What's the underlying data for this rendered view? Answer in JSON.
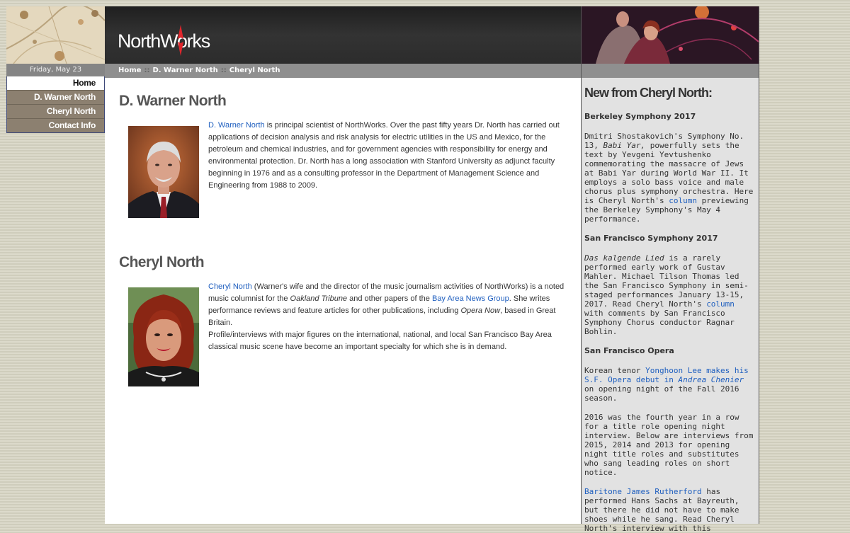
{
  "left": {
    "date": "Friday, May 23",
    "nav": [
      {
        "label": "Home",
        "active": true
      },
      {
        "label": "D. Warner North",
        "active": false
      },
      {
        "label": "Cheryl North",
        "active": false
      },
      {
        "label": "Contact Info",
        "active": false
      }
    ]
  },
  "header": {
    "logo": "NorthWorks",
    "breadcrumbs": [
      "Home",
      "D. Warner North",
      "Cheryl North"
    ],
    "separator": "::"
  },
  "warner": {
    "name": "D. Warner North",
    "bio_link": "D. Warner North",
    "bio_rest": " is principal scientist of NorthWorks. Over the past fifty years Dr. North has carried out applications of decision analysis and risk analysis for electric utilities in the US and Mexico, for the petroleum and chemical industries, and for government agencies with responsibility for energy and environmental protection. Dr. North has a long association with Stanford University as adjunct faculty beginning in 1976 and as a consulting professor in the Department of Management Science and Engineering from 1988 to 2009."
  },
  "cheryl": {
    "name": "Cheryl North",
    "bio_link": "Cheryl North",
    "bio_1": " (Warner's wife and the director of the music journalism activities of NorthWorks) is a noted music columnist for the ",
    "bio_italic_1": "Oakland Tribune",
    "bio_2": " and other papers of the ",
    "bio_link_2": "Bay Area News Group",
    "bio_3": ". She writes performance reviews and feature articles for other publications, including ",
    "bio_italic_2": "Opera Now",
    "bio_4": ", based in Great Britain.",
    "bio_para_2": "Profile/interviews with major figures on the international, national, and local San Francisco Bay Area classical music scene have become an important specialty for which she is in demand."
  },
  "sidebar": {
    "title": "New from Cheryl North:",
    "s1_title": "Berkeley Symphony 2017",
    "s1_a": "Dmitri Shostakovich's Symphony No. 13, ",
    "s1_italic": "Babi Yar,",
    "s1_b": " powerfully sets the text by Yevgeni Yevtushenko commemorating the massacre of Jews at Babi Yar during World War II. It employs a solo bass voice and male chorus plus symphony orchestra. Here is Cheryl North's ",
    "s1_link": "column",
    "s1_c": " previewing the Berkeley Symphony's May 4 performance.",
    "s2_title": "San Francisco Symphony 2017",
    "s2_italic": "Das kalgende Lied",
    "s2_a": " is a rarely performed early work of Gustav Mahler. Michael Tilson Thomas led the San Francisco Symphony in semi-staged performances January 13-15, 2017. Read Cheryl North's ",
    "s2_link": "column",
    "s2_b": " with comments by San Francisco Symphony Chorus conductor Ragnar Bohlin.",
    "s3_title": "San Francisco Opera",
    "s3_a": "Korean tenor ",
    "s3_link_a": "Yonghoon Lee makes his S.F. Opera debut in ",
    "s3_link_italic": "Andrea Chenier",
    "s3_b": " on opening night of the Fall 2016 season.",
    "s3_p2": "2016 was the fourth year in a row for a title role opening night interview. Below are interviews from 2015, 2014 and 2013 for opening night title roles and substitutes who sang leading roles on short notice.",
    "s3_link_b": "Baritone James Rutherford",
    "s3_c": " has performed Hans Sachs at Bayreuth, but there he did not have to make shoes while he sang. Read Cheryl North's interview with this"
  }
}
